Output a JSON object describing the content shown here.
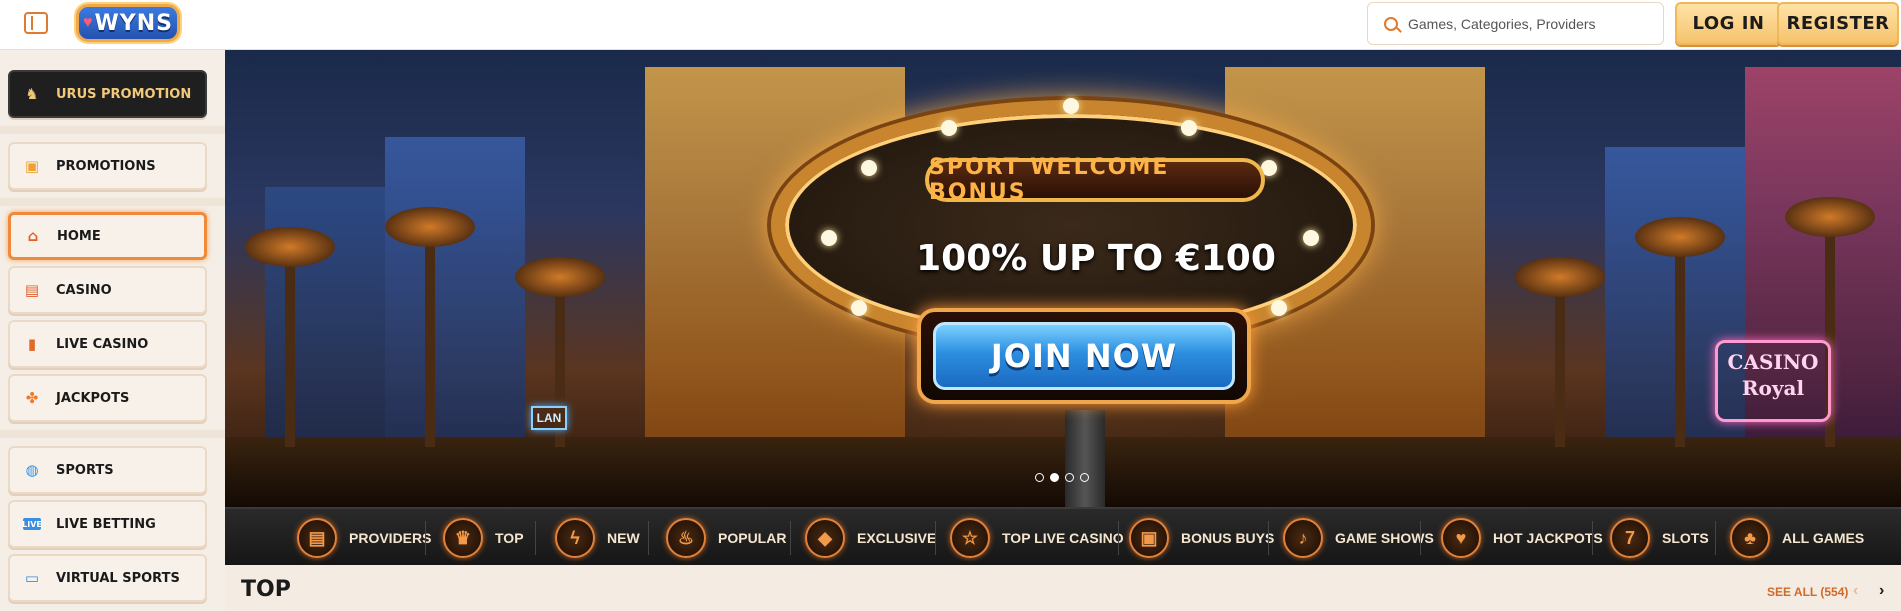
{
  "header": {
    "logo_text": "WYNS",
    "search_placeholder": "Games, Categories, Providers",
    "login_label": "LOG IN",
    "register_label": "REGISTER"
  },
  "sidebar": {
    "items": [
      {
        "label": "URUS PROMOTION",
        "icon": "bull-icon"
      },
      {
        "label": "PROMOTIONS",
        "icon": "gift-icon"
      },
      {
        "label": "HOME",
        "icon": "home-icon"
      },
      {
        "label": "CASINO",
        "icon": "slot-machine-icon"
      },
      {
        "label": "LIVE CASINO",
        "icon": "cards-icon"
      },
      {
        "label": "JACKPOTS",
        "icon": "clover-icon"
      },
      {
        "label": "SPORTS",
        "icon": "ball-icon"
      },
      {
        "label": "LIVE BETTING",
        "icon": "live-icon"
      },
      {
        "label": "VIRTUAL SPORTS",
        "icon": "monitor-icon"
      }
    ],
    "active": "HOME"
  },
  "banner": {
    "title": "SPORT WELCOME BONUS",
    "offer": "100% UP TO €100",
    "cta": "JOIN NOW",
    "slides": 4,
    "active_slide": 2,
    "neon_sign": "CASINO Royal",
    "neon_small": "LAN"
  },
  "categories": [
    {
      "label": "PROVIDERS",
      "icon": "document-icon"
    },
    {
      "label": "TOP",
      "icon": "crown-icon"
    },
    {
      "label": "NEW",
      "icon": "lightning-icon"
    },
    {
      "label": "POPULAR",
      "icon": "flame-icon"
    },
    {
      "label": "EXCLUSIVE",
      "icon": "diamond-icon"
    },
    {
      "label": "TOP LIVE CASINO",
      "icon": "star-icon"
    },
    {
      "label": "BONUS BUYS",
      "icon": "gift-icon"
    },
    {
      "label": "GAME SHOWS",
      "icon": "microphone-icon"
    },
    {
      "label": "HOT JACKPOTS",
      "icon": "heart-icon"
    },
    {
      "label": "SLOTS",
      "icon": "slot-machine-icon"
    },
    {
      "label": "ALL GAMES",
      "icon": "cherries-icon"
    }
  ],
  "section": {
    "title": "TOP",
    "see_all": "SEE ALL (554)"
  },
  "colors": {
    "accent": "#e07a2e",
    "button_gold": "#f5c36d",
    "cta_blue": "#2c8ee0",
    "dark_bar": "#1f1f1f"
  }
}
